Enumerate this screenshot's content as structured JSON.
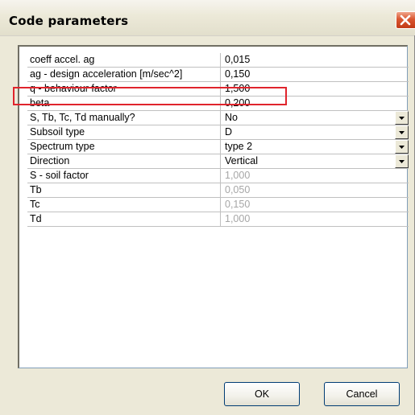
{
  "window": {
    "title": "Code parameters"
  },
  "rows": [
    {
      "label": "coeff accel. ag",
      "value": "0,015",
      "disabled": false,
      "dropdown": false
    },
    {
      "label": "ag - design acceleration [m/sec^2]",
      "value": "0,150",
      "disabled": false,
      "dropdown": false
    },
    {
      "label": "q - behaviour factor",
      "value": "1,500",
      "disabled": false,
      "dropdown": false
    },
    {
      "label": "beta",
      "value": "0,200",
      "disabled": false,
      "dropdown": false
    },
    {
      "label": "S, Tb, Tc, Td manually?",
      "value": "No",
      "disabled": false,
      "dropdown": true
    },
    {
      "label": "Subsoil type",
      "value": "D",
      "disabled": false,
      "dropdown": true
    },
    {
      "label": "Spectrum type",
      "value": "type 2",
      "disabled": false,
      "dropdown": true
    },
    {
      "label": "Direction",
      "value": "Vertical",
      "disabled": false,
      "dropdown": true
    },
    {
      "label": "S - soil factor",
      "value": "1,000",
      "disabled": true,
      "dropdown": false
    },
    {
      "label": "Tb",
      "value": "0,050",
      "disabled": true,
      "dropdown": false
    },
    {
      "label": "Tc",
      "value": "0,150",
      "disabled": true,
      "dropdown": false
    },
    {
      "label": "Td",
      "value": "1,000",
      "disabled": true,
      "dropdown": false
    }
  ],
  "buttons": {
    "ok": "OK",
    "cancel": "Cancel"
  },
  "colors": {
    "highlight": "#e0242c",
    "disabled_text": "#a6a6a6",
    "close_button": "#d9552f"
  }
}
